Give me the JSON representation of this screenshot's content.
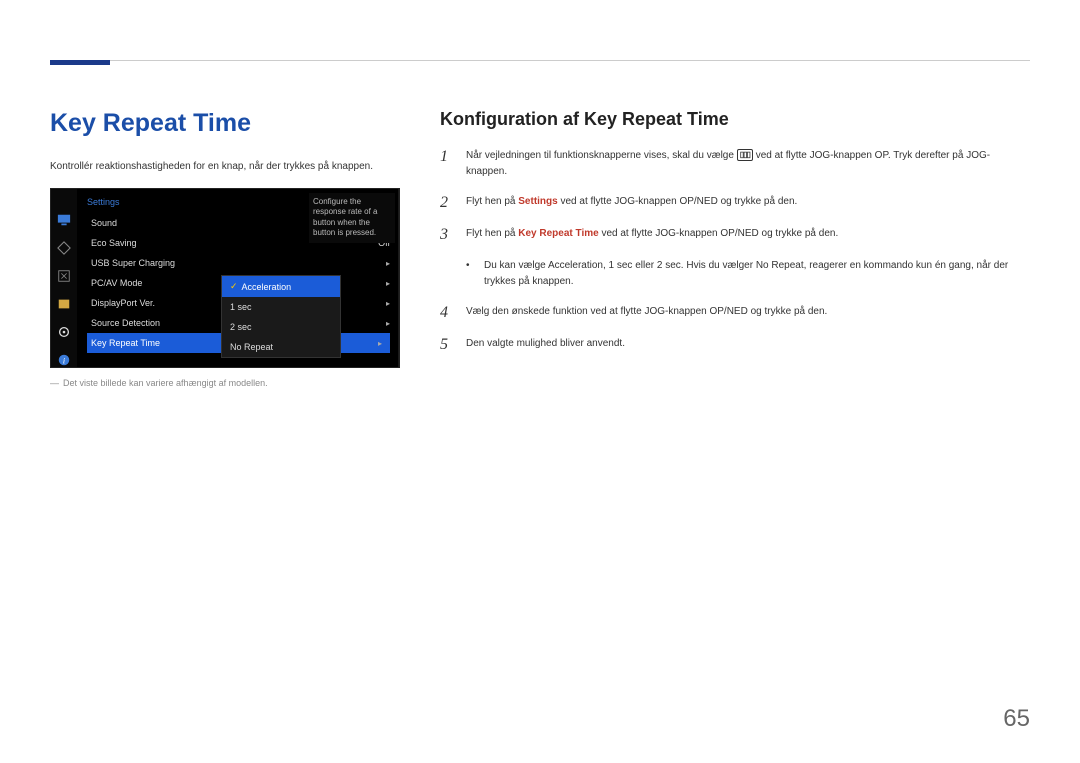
{
  "page_number": "65",
  "section_title": "Key Repeat Time",
  "intro": "Kontrollér reaktionshastigheden for en knap, når der trykkes på knappen.",
  "osd": {
    "header": "Settings",
    "items": [
      {
        "label": "Sound",
        "value": ""
      },
      {
        "label": "Eco Saving",
        "value": "Off"
      },
      {
        "label": "USB Super Charging",
        "value": ""
      },
      {
        "label": "PC/AV Mode",
        "value": ""
      },
      {
        "label": "DisplayPort Ver.",
        "value": ""
      },
      {
        "label": "Source Detection",
        "value": ""
      },
      {
        "label": "Key Repeat Time",
        "value": ""
      }
    ],
    "submenu": [
      "Acceleration",
      "1 sec",
      "2 sec",
      "No Repeat"
    ],
    "tooltip": "Configure the response rate of a button when the button is pressed."
  },
  "caption": "Det viste billede kan variere afhængigt af modellen.",
  "config_title": "Konfiguration af Key Repeat Time",
  "steps": {
    "s1a": "Når vejledningen til funktionsknapperne vises, skal du vælge ",
    "s1b": " ved at flytte JOG-knappen OP. Tryk derefter på JOG-knappen.",
    "s2a": "Flyt hen på ",
    "s2em": "Settings",
    "s2b": " ved at flytte JOG-knappen OP/NED og trykke på den.",
    "s3a": "Flyt hen på ",
    "s3em": "Key Repeat Time",
    "s3b": " ved at flytte JOG-knappen OP/NED og trykke på den.",
    "bullet_a": "Du kan vælge ",
    "bullet_e1": "Acceleration",
    "bullet_c1": ", ",
    "bullet_e2": "1 sec",
    "bullet_c2": " eller ",
    "bullet_e3": "2 sec",
    "bullet_c3": ". Hvis du vælger ",
    "bullet_e4": "No Repeat",
    "bullet_b": ", reagerer en kommando kun én gang, når der trykkes på knappen.",
    "s4": "Vælg den ønskede funktion ved at flytte JOG-knappen OP/NED og trykke på den.",
    "s5": "Den valgte mulighed bliver anvendt."
  }
}
